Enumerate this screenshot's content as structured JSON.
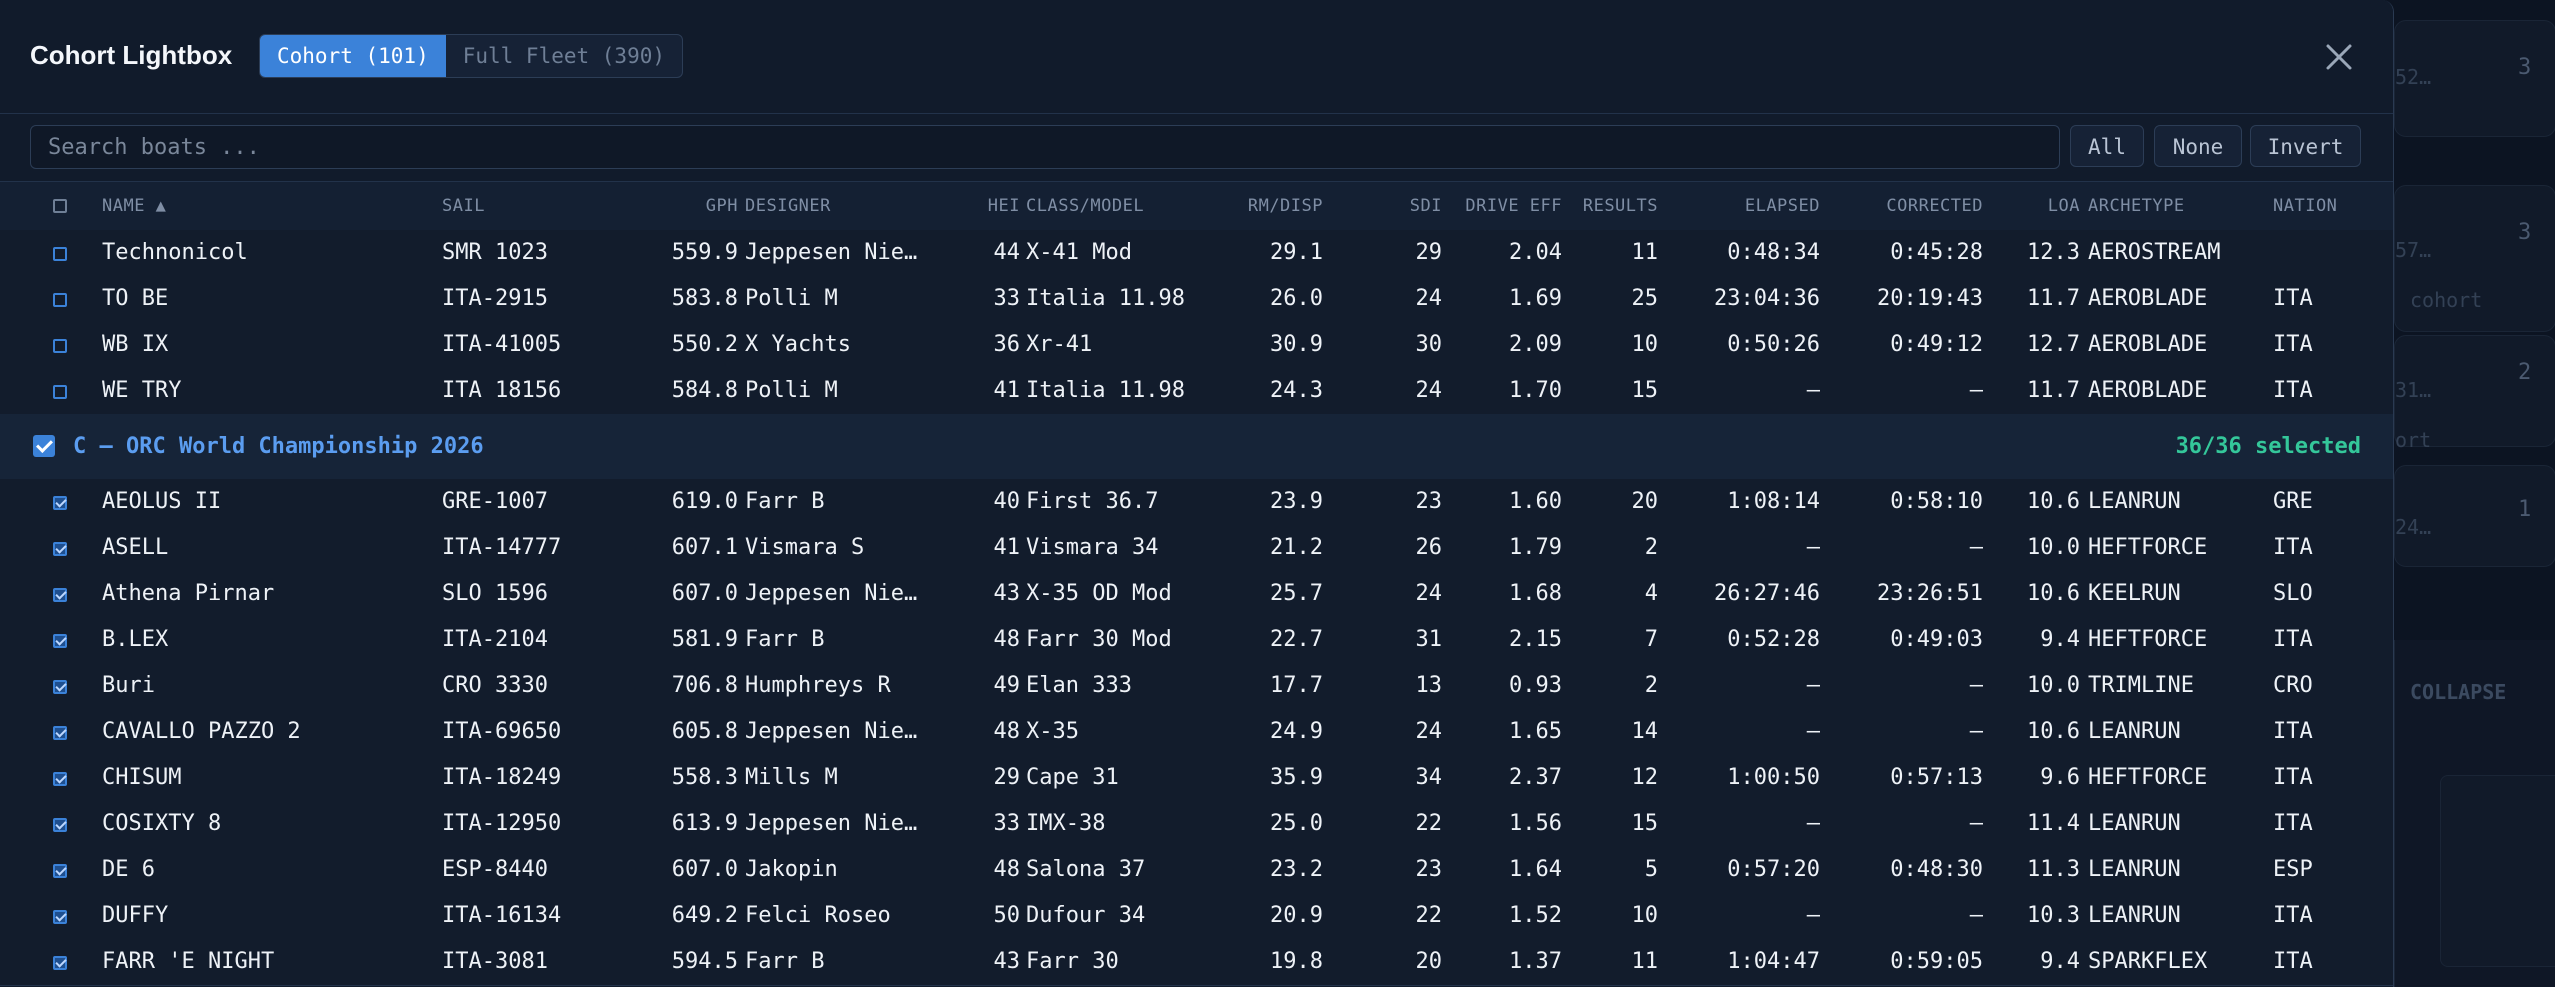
{
  "modal": {
    "title": "Cohort Lightbox",
    "tabs": [
      {
        "label": "Cohort (101)",
        "active": true
      },
      {
        "label": "Full Fleet (390)",
        "active": false
      }
    ]
  },
  "search": {
    "placeholder": "Search boats ..."
  },
  "actions": {
    "all": "All",
    "none": "None",
    "invert": "Invert"
  },
  "columns": {
    "name": "NAME ▲",
    "sail": "SAIL",
    "gph": "GPH",
    "designer": "DESIGNER",
    "hei": "HEI",
    "class_model": "CLASS/MODEL",
    "rm_disp": "RM/DISP",
    "sdi": "SDI",
    "drive_eff": "DRIVE EFF",
    "results": "RESULTS",
    "elapsed": "ELAPSED",
    "corrected": "CORRECTED",
    "loa": "LOA",
    "archetype": "ARCHETYPE",
    "nation": "NATION"
  },
  "rows_top": [
    {
      "name": "Technonicol",
      "sail": "SMR 1023",
      "gph": "559.9",
      "designer": "Jeppesen Nie…",
      "hei": "44",
      "model": "X-41 Mod",
      "rm": "29.1",
      "sdi": "29",
      "drive": "2.04",
      "results": "11",
      "elapsed": "0:48:34",
      "corrected": "0:45:28",
      "loa": "12.3",
      "arch": "AEROSTREAM",
      "nation": ""
    },
    {
      "name": "TO BE",
      "sail": "ITA-2915",
      "gph": "583.8",
      "designer": "Polli M",
      "hei": "33",
      "model": "Italia 11.98",
      "rm": "26.0",
      "sdi": "24",
      "drive": "1.69",
      "results": "25",
      "elapsed": "23:04:36",
      "corrected": "20:19:43",
      "loa": "11.7",
      "arch": "AEROBLADE",
      "nation": "ITA"
    },
    {
      "name": "WB IX",
      "sail": "ITA-41005",
      "gph": "550.2",
      "designer": "X Yachts",
      "hei": "36",
      "model": "Xr-41",
      "rm": "30.9",
      "sdi": "30",
      "drive": "2.09",
      "results": "10",
      "elapsed": "0:50:26",
      "corrected": "0:49:12",
      "loa": "12.7",
      "arch": "AEROBLADE",
      "nation": "ITA"
    },
    {
      "name": "WE TRY",
      "sail": "ITA 18156",
      "gph": "584.8",
      "designer": "Polli M",
      "hei": "41",
      "model": "Italia 11.98",
      "rm": "24.3",
      "sdi": "24",
      "drive": "1.70",
      "results": "15",
      "elapsed": "–",
      "corrected": "–",
      "loa": "11.7",
      "arch": "AEROBLADE",
      "nation": "ITA"
    }
  ],
  "group": {
    "title": "C – ORC World Championship 2026",
    "count": "36/36 selected"
  },
  "rows_group": [
    {
      "name": "AEOLUS II",
      "sail": "GRE-1007",
      "gph": "619.0",
      "designer": "Farr B",
      "hei": "40",
      "model": "First 36.7",
      "rm": "23.9",
      "sdi": "23",
      "drive": "1.60",
      "results": "20",
      "elapsed": "1:08:14",
      "corrected": "0:58:10",
      "loa": "10.6",
      "arch": "LEANRUN",
      "nation": "GRE"
    },
    {
      "name": "ASELL",
      "sail": "ITA-14777",
      "gph": "607.1",
      "designer": "Vismara S",
      "hei": "41",
      "model": "Vismara 34",
      "rm": "21.2",
      "sdi": "26",
      "drive": "1.79",
      "results": "2",
      "elapsed": "–",
      "corrected": "–",
      "loa": "10.0",
      "arch": "HEFTFORCE",
      "nation": "ITA"
    },
    {
      "name": "Athena Pirnar",
      "sail": "SLO 1596",
      "gph": "607.0",
      "designer": "Jeppesen Nie…",
      "hei": "43",
      "model": "X-35 OD Mod",
      "rm": "25.7",
      "sdi": "24",
      "drive": "1.68",
      "results": "4",
      "elapsed": "26:27:46",
      "corrected": "23:26:51",
      "loa": "10.6",
      "arch": "KEELRUN",
      "nation": "SLO"
    },
    {
      "name": "B.LEX",
      "sail": "ITA-2104",
      "gph": "581.9",
      "designer": "Farr B",
      "hei": "48",
      "model": "Farr 30 Mod",
      "rm": "22.7",
      "sdi": "31",
      "drive": "2.15",
      "results": "7",
      "elapsed": "0:52:28",
      "corrected": "0:49:03",
      "loa": "9.4",
      "arch": "HEFTFORCE",
      "nation": "ITA"
    },
    {
      "name": "Buri",
      "sail": "CRO 3330",
      "gph": "706.8",
      "designer": "Humphreys R",
      "hei": "49",
      "model": "Elan 333",
      "rm": "17.7",
      "sdi": "13",
      "drive": "0.93",
      "results": "2",
      "elapsed": "–",
      "corrected": "–",
      "loa": "10.0",
      "arch": "TRIMLINE",
      "nation": "CRO"
    },
    {
      "name": "CAVALLO PAZZO 2",
      "sail": "ITA-69650",
      "gph": "605.8",
      "designer": "Jeppesen Nie…",
      "hei": "48",
      "model": "X-35",
      "rm": "24.9",
      "sdi": "24",
      "drive": "1.65",
      "results": "14",
      "elapsed": "–",
      "corrected": "–",
      "loa": "10.6",
      "arch": "LEANRUN",
      "nation": "ITA"
    },
    {
      "name": "CHISUM",
      "sail": "ITA-18249",
      "gph": "558.3",
      "designer": "Mills M",
      "hei": "29",
      "model": "Cape 31",
      "rm": "35.9",
      "sdi": "34",
      "drive": "2.37",
      "results": "12",
      "elapsed": "1:00:50",
      "corrected": "0:57:13",
      "loa": "9.6",
      "arch": "HEFTFORCE",
      "nation": "ITA"
    },
    {
      "name": "COSIXTY 8",
      "sail": "ITA-12950",
      "gph": "613.9",
      "designer": "Jeppesen Nie…",
      "hei": "33",
      "model": "IMX-38",
      "rm": "25.0",
      "sdi": "22",
      "drive": "1.56",
      "results": "15",
      "elapsed": "–",
      "corrected": "–",
      "loa": "11.4",
      "arch": "LEANRUN",
      "nation": "ITA"
    },
    {
      "name": "DE 6",
      "sail": "ESP-8440",
      "gph": "607.0",
      "designer": "Jakopin",
      "hei": "48",
      "model": "Salona 37",
      "rm": "23.2",
      "sdi": "23",
      "drive": "1.64",
      "results": "5",
      "elapsed": "0:57:20",
      "corrected": "0:48:30",
      "loa": "11.3",
      "arch": "LEANRUN",
      "nation": "ESP"
    },
    {
      "name": "DUFFY",
      "sail": "ITA-16134",
      "gph": "649.2",
      "designer": "Felci Roseo",
      "hei": "50",
      "model": "Dufour 34",
      "rm": "20.9",
      "sdi": "22",
      "drive": "1.52",
      "results": "10",
      "elapsed": "–",
      "corrected": "–",
      "loa": "10.3",
      "arch": "LEANRUN",
      "nation": "ITA"
    },
    {
      "name": "FARR 'E NIGHT",
      "sail": "ITA-3081",
      "gph": "594.5",
      "designer": "Farr B",
      "hei": "43",
      "model": "Farr 30",
      "rm": "19.8",
      "sdi": "20",
      "drive": "1.37",
      "results": "11",
      "elapsed": "1:04:47",
      "corrected": "0:59:05",
      "loa": "9.4",
      "arch": "SPARKFLEX",
      "nation": "ITA"
    }
  ],
  "background": {
    "cards": [
      {
        "text": "52…",
        "num": "3"
      },
      {
        "text": "57…",
        "num": "3",
        "sub": "cohort"
      },
      {
        "text": "31…",
        "num": "2",
        "sub": "ort"
      },
      {
        "text": "24…",
        "num": "1"
      }
    ],
    "collapse_label": "COLLAPSE"
  }
}
